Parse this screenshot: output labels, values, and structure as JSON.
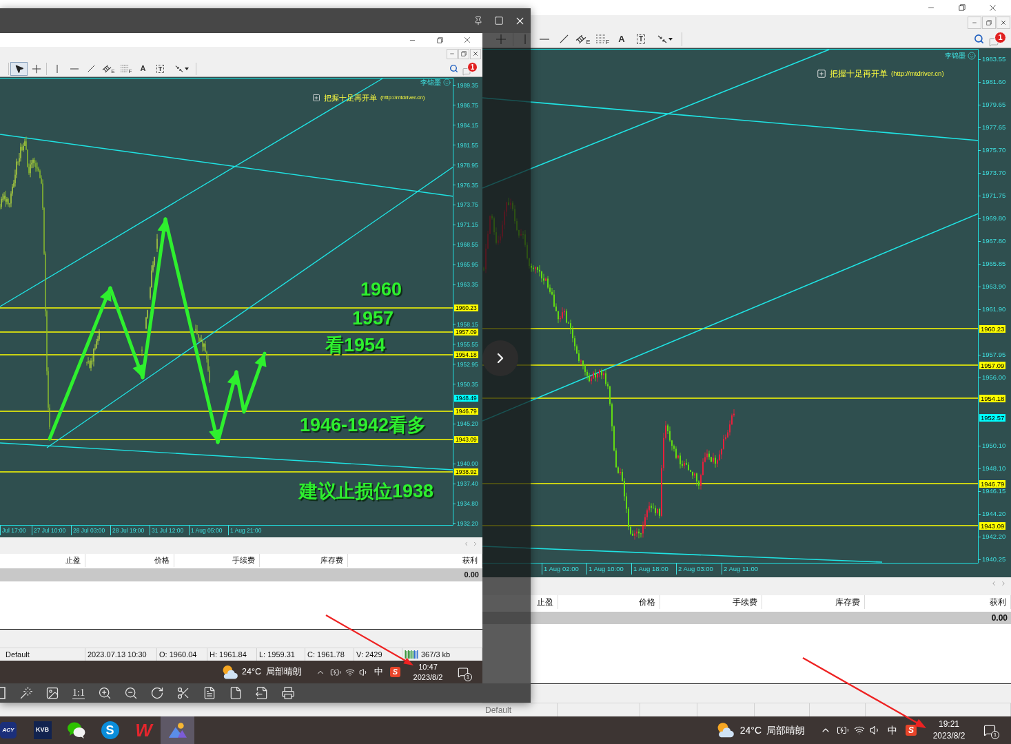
{
  "main_window": {
    "toolbar": {
      "tools": [
        {
          "kind": "crosshair",
          "selected": false
        },
        {
          "kind": "separator"
        },
        {
          "kind": "vline",
          "selected": false
        },
        {
          "kind": "hline",
          "selected": false
        },
        {
          "kind": "trendline",
          "selected": false
        },
        {
          "kind": "channel",
          "label": "E",
          "selected": false
        },
        {
          "kind": "fibo",
          "label": "F",
          "selected": false
        },
        {
          "kind": "text",
          "label": "A",
          "selected": false
        },
        {
          "kind": "textlabel",
          "label": "T",
          "selected": false
        },
        {
          "kind": "arrows",
          "selected": false
        },
        {
          "kind": "separator"
        }
      ],
      "alert_badge": "1"
    },
    "chart": {
      "corner_label": "李锦墨",
      "banner": {
        "title": "把握十足再开单",
        "link": "(http://mtdriver.cn)"
      },
      "price_axis": [
        "1983.55",
        "1981.60",
        "1979.65",
        "1977.65",
        "1975.70",
        "1973.70",
        "1971.75",
        "1969.80",
        "1967.80",
        "1965.85",
        "1963.90",
        "1961.90",
        "1957.95",
        "1956.00",
        "1950.10",
        "1948.10",
        "1946.15",
        "1944.20",
        "1942.20",
        "1940.25"
      ],
      "price_tags": [
        {
          "text": "1960.23",
          "kind": "level"
        },
        {
          "text": "1957.09",
          "kind": "level"
        },
        {
          "text": "1954.18",
          "kind": "level"
        },
        {
          "text": "1952.57",
          "kind": "bid"
        },
        {
          "text": "1946.79",
          "kind": "level"
        },
        {
          "text": "1943.09",
          "kind": "level"
        }
      ],
      "time_axis": [
        "1 Aug 02:00",
        "1 Aug 10:00",
        "1 Aug 18:00",
        "2 Aug 03:00",
        "2 Aug 11:00"
      ]
    },
    "trade_table": {
      "columns": [
        "止盈",
        "价格",
        "手续费",
        "库存费",
        "获利"
      ],
      "rows": [
        {
          "profit": "0.00"
        }
      ]
    },
    "status_bar": {
      "cells": [
        {
          "kind": "text",
          "text": "Default"
        }
      ]
    }
  },
  "image_viewer": {
    "screenshot": {
      "toolbar": {
        "tools": [
          {
            "kind": "separator"
          },
          {
            "kind": "cursor",
            "selected": true
          },
          {
            "kind": "crosshair",
            "selected": false
          },
          {
            "kind": "separator"
          },
          {
            "kind": "vline",
            "selected": false
          },
          {
            "kind": "hline",
            "selected": false
          },
          {
            "kind": "trendline",
            "selected": false
          },
          {
            "kind": "channel",
            "label": "E",
            "selected": false
          },
          {
            "kind": "fibo",
            "label": "F",
            "selected": false
          },
          {
            "kind": "text",
            "label": "A",
            "selected": false
          },
          {
            "kind": "textlabel",
            "label": "T",
            "selected": false
          },
          {
            "kind": "arrows",
            "selected": false
          },
          {
            "kind": "separator"
          }
        ],
        "alert_badge": "1"
      },
      "chart": {
        "corner_label": "李锦墨",
        "banner": {
          "title": "把握十足再开单",
          "link": "(http://mtdriver.cn)"
        },
        "price_axis": [
          "1989.35",
          "1986.75",
          "1984.15",
          "1981.55",
          "1978.95",
          "1976.35",
          "1973.75",
          "1971.15",
          "1968.55",
          "1965.95",
          "1963.35",
          "1958.15",
          "1955.55",
          "1952.95",
          "1950.35",
          "1945.20",
          "1940.00",
          "1937.40",
          "1934.80",
          "1932.20"
        ],
        "price_tags": [
          {
            "text": "1960.23",
            "kind": "level"
          },
          {
            "text": "1957.09",
            "kind": "level"
          },
          {
            "text": "1954.18",
            "kind": "level"
          },
          {
            "text": "1948.49",
            "kind": "bid"
          },
          {
            "text": "1946.79",
            "kind": "level"
          },
          {
            "text": "1943.09",
            "kind": "level"
          },
          {
            "text": "1938.92",
            "kind": "level"
          }
        ],
        "time_axis": [
          "Jul 17:00",
          "27 Jul 10:00",
          "28 Jul 03:00",
          "28 Jul 19:00",
          "31 Jul 12:00",
          "1 Aug 05:00",
          "1 Aug 21:00"
        ],
        "annotations": [
          "1960",
          "1957",
          "看1954",
          "1946-1942看多",
          "建议止损位1938"
        ]
      },
      "trade_table": {
        "columns": [
          "止盈",
          "价格",
          "手续费",
          "库存费",
          "获利"
        ],
        "rows": [
          {
            "profit": "0.00"
          }
        ]
      },
      "status_bar": {
        "cells": [
          {
            "kind": "text",
            "text": "Default"
          },
          {
            "kind": "text",
            "text": "2023.07.13 10:30"
          },
          {
            "kind": "text",
            "text": "O: 1960.04"
          },
          {
            "kind": "text",
            "text": "H: 1961.84"
          },
          {
            "kind": "text",
            "text": "L: 1959.31"
          },
          {
            "kind": "text",
            "text": "C: 1961.78"
          },
          {
            "kind": "text",
            "text": "V: 2429"
          },
          {
            "kind": "traffic",
            "text": "367/3 kb"
          }
        ]
      },
      "taskbar": {
        "tray": {
          "temperature": "24°C",
          "weather": "局部晴朗",
          "input_mode": "中",
          "input_method_logo": "S",
          "time": "10:47",
          "date": "2023/8/2",
          "notification_count": "1"
        }
      }
    },
    "toolbar": {
      "tools": [
        {
          "kind": "frame"
        },
        {
          "kind": "wand"
        },
        {
          "kind": "edit"
        },
        {
          "kind": "actual-size",
          "label": "1:1"
        },
        {
          "kind": "zoom-in"
        },
        {
          "kind": "zoom-out"
        },
        {
          "kind": "rotate"
        },
        {
          "kind": "crop"
        },
        {
          "kind": "to-doc"
        },
        {
          "kind": "to-pdf"
        },
        {
          "kind": "save-as"
        },
        {
          "kind": "print"
        }
      ]
    }
  },
  "taskbar": {
    "apps": [
      {
        "kind": "badge-logo",
        "logo": "ACY",
        "selected": false
      },
      {
        "kind": "tile-logo",
        "logo": "KVB",
        "selected": false
      },
      {
        "kind": "chat",
        "selected": false
      },
      {
        "kind": "bubble-logo",
        "logo": "S",
        "selected": false
      },
      {
        "kind": "letter-logo",
        "logo": "W",
        "selected": false
      },
      {
        "kind": "photos",
        "selected": true
      }
    ],
    "tray": {
      "temperature": "24°C",
      "weather": "局部晴朗",
      "input_mode": "中",
      "input_method_logo": "S",
      "time": "19:21",
      "date": "2023/8/2",
      "notification_count": "1"
    }
  }
}
